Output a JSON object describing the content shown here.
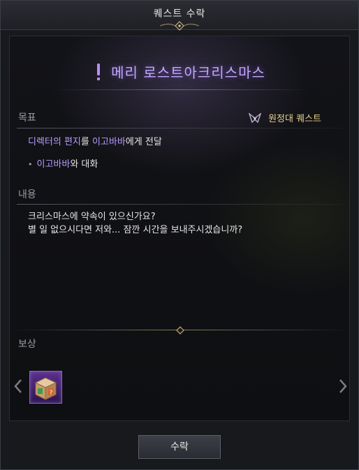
{
  "window": {
    "title": "퀘스트 수락"
  },
  "quest": {
    "title": "메리 로스트아크리스마스",
    "type_label": "원정대 퀘스트"
  },
  "objective": {
    "label": "목표",
    "main": {
      "item": "디렉터의 편지",
      "particle": "를 ",
      "target": "이고바바",
      "suffix": "에게 전달"
    },
    "sub": {
      "target": "이고바바",
      "suffix": "와 대화"
    }
  },
  "content": {
    "label": "내용",
    "lines": [
      "크리스마스에 약속이 있으신가요?",
      "별 일 없으시다면 저와... 잠깐 시간을 보내주시겠습니까?"
    ]
  },
  "reward": {
    "label": "보상",
    "items": [
      {
        "icon": "mystery-box-icon"
      }
    ]
  },
  "buttons": {
    "accept": "수락"
  },
  "colors": {
    "quest_title": "#c3a6ff",
    "highlight": "#b99bff",
    "quest_type": "#e8cf8a"
  }
}
